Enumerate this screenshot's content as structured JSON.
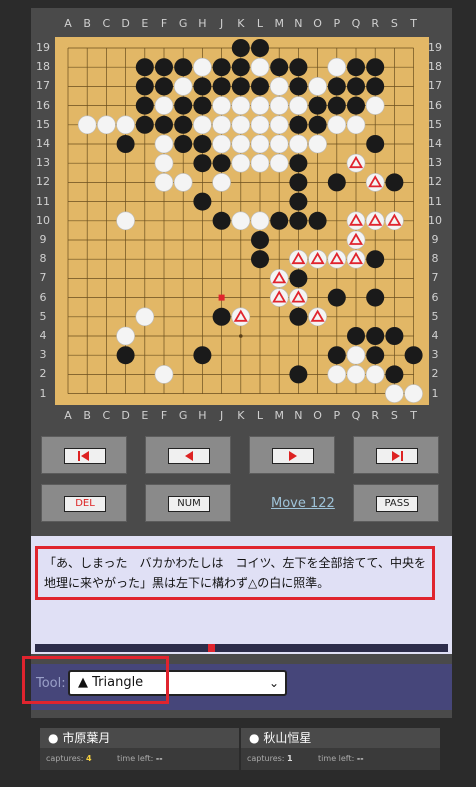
{
  "board": {
    "col_labels": [
      "A",
      "B",
      "C",
      "D",
      "E",
      "F",
      "G",
      "H",
      "J",
      "K",
      "L",
      "M",
      "N",
      "O",
      "P",
      "Q",
      "R",
      "S",
      "T"
    ],
    "row_labels": [
      "19",
      "18",
      "17",
      "16",
      "15",
      "14",
      "13",
      "12",
      "11",
      "10",
      "9",
      "8",
      "7",
      "6",
      "5",
      "4",
      "3",
      "2",
      "1"
    ],
    "star_points": [
      [
        3,
        9
      ],
      [
        9,
        9
      ],
      [
        9,
        15
      ],
      [
        15,
        3
      ],
      [
        15,
        9
      ]
    ],
    "black_stones": [
      [
        9,
        0
      ],
      [
        10,
        0
      ],
      [
        4,
        1
      ],
      [
        5,
        1
      ],
      [
        6,
        1
      ],
      [
        8,
        1
      ],
      [
        9,
        1
      ],
      [
        11,
        1
      ],
      [
        12,
        1
      ],
      [
        15,
        1
      ],
      [
        16,
        1
      ],
      [
        4,
        2
      ],
      [
        5,
        2
      ],
      [
        7,
        2
      ],
      [
        8,
        2
      ],
      [
        9,
        2
      ],
      [
        10,
        2
      ],
      [
        12,
        2
      ],
      [
        14,
        2
      ],
      [
        15,
        2
      ],
      [
        16,
        2
      ],
      [
        4,
        3
      ],
      [
        6,
        3
      ],
      [
        7,
        3
      ],
      [
        13,
        3
      ],
      [
        14,
        3
      ],
      [
        15,
        3
      ],
      [
        4,
        4
      ],
      [
        5,
        4
      ],
      [
        6,
        4
      ],
      [
        7,
        4
      ],
      [
        12,
        4
      ],
      [
        13,
        4
      ],
      [
        3,
        5
      ],
      [
        6,
        5
      ],
      [
        7,
        5
      ],
      [
        16,
        5
      ],
      [
        7,
        6
      ],
      [
        8,
        6
      ],
      [
        12,
        6
      ],
      [
        12,
        7
      ],
      [
        14,
        7
      ],
      [
        17,
        7
      ],
      [
        7,
        8
      ],
      [
        12,
        8
      ],
      [
        8,
        9
      ],
      [
        11,
        9
      ],
      [
        12,
        9
      ],
      [
        13,
        9
      ],
      [
        10,
        10
      ],
      [
        10,
        11
      ],
      [
        13,
        11
      ],
      [
        16,
        11
      ],
      [
        11,
        12
      ],
      [
        12,
        12
      ],
      [
        11,
        13
      ],
      [
        14,
        13
      ],
      [
        16,
        13
      ],
      [
        8,
        14
      ],
      [
        12,
        14
      ],
      [
        13,
        14
      ],
      [
        15,
        15
      ],
      [
        16,
        15
      ],
      [
        17,
        15
      ],
      [
        3,
        16
      ],
      [
        7,
        16
      ],
      [
        14,
        16
      ],
      [
        15,
        16
      ],
      [
        16,
        16
      ],
      [
        18,
        16
      ],
      [
        12,
        17
      ],
      [
        17,
        17
      ]
    ],
    "white_stones": [
      [
        7,
        1
      ],
      [
        10,
        1
      ],
      [
        14,
        1
      ],
      [
        6,
        2
      ],
      [
        11,
        2
      ],
      [
        13,
        2
      ],
      [
        5,
        3
      ],
      [
        8,
        3
      ],
      [
        9,
        3
      ],
      [
        10,
        3
      ],
      [
        11,
        3
      ],
      [
        12,
        3
      ],
      [
        16,
        3
      ],
      [
        1,
        4
      ],
      [
        2,
        4
      ],
      [
        3,
        4
      ],
      [
        7,
        4
      ],
      [
        8,
        4
      ],
      [
        9,
        4
      ],
      [
        10,
        4
      ],
      [
        11,
        4
      ],
      [
        14,
        4
      ],
      [
        15,
        4
      ],
      [
        5,
        5
      ],
      [
        8,
        5
      ],
      [
        9,
        5
      ],
      [
        10,
        5
      ],
      [
        11,
        5
      ],
      [
        12,
        5
      ],
      [
        13,
        5
      ],
      [
        5,
        6
      ],
      [
        9,
        6
      ],
      [
        10,
        6
      ],
      [
        11,
        6
      ],
      [
        5,
        7
      ],
      [
        6,
        7
      ],
      [
        8,
        7
      ],
      [
        3,
        9
      ],
      [
        9,
        9
      ],
      [
        10,
        9
      ],
      [
        4,
        14
      ],
      [
        3,
        15
      ],
      [
        5,
        17
      ],
      [
        15,
        16
      ],
      [
        14,
        17
      ],
      [
        15,
        17
      ],
      [
        16,
        17
      ],
      [
        17,
        18
      ],
      [
        18,
        18
      ]
    ],
    "triangle_marks": [
      [
        15,
        6
      ],
      [
        16,
        7
      ],
      [
        15,
        9
      ],
      [
        16,
        9
      ],
      [
        17,
        9
      ],
      [
        15,
        10
      ],
      [
        12,
        11
      ],
      [
        13,
        11
      ],
      [
        14,
        11
      ],
      [
        15,
        11
      ],
      [
        11,
        12
      ],
      [
        11,
        13
      ],
      [
        12,
        13
      ],
      [
        13,
        14
      ],
      [
        9,
        14
      ]
    ],
    "last_move": [
      8,
      13
    ],
    "colors": {
      "board": "#e2b766",
      "black": "#1a1a1a",
      "white": "#f4f4f4",
      "triangle": "#e0242e",
      "last_move": "#e0242e"
    }
  },
  "nav": {
    "first_icon": "first-move-icon",
    "prev_icon": "previous-move-icon",
    "next_icon": "next-move-icon",
    "last_icon": "last-move-icon",
    "del_label": "DEL",
    "num_label": "NUM",
    "move_label": "Move 122",
    "pass_label": "PASS"
  },
  "comment": {
    "text": "「あ、しまった　バカかわたしは　コイツ、左下を全部捨てて、中央を地理に来やがった」黒は左下に構わず△の白に照準。"
  },
  "progress": {
    "value": 0.42
  },
  "tool": {
    "label": "Tool:",
    "selected": "▲ Triangle",
    "chevron_icon": "chevron-down-icon"
  },
  "players": {
    "black": {
      "name": "市原葉月",
      "captures_label": "captures:",
      "captures": "4",
      "time_label": "time left:",
      "time": "--"
    },
    "white": {
      "name": "秋山恒星",
      "captures_label": "captures:",
      "captures": "1",
      "time_label": "time left:",
      "time": "--"
    }
  }
}
